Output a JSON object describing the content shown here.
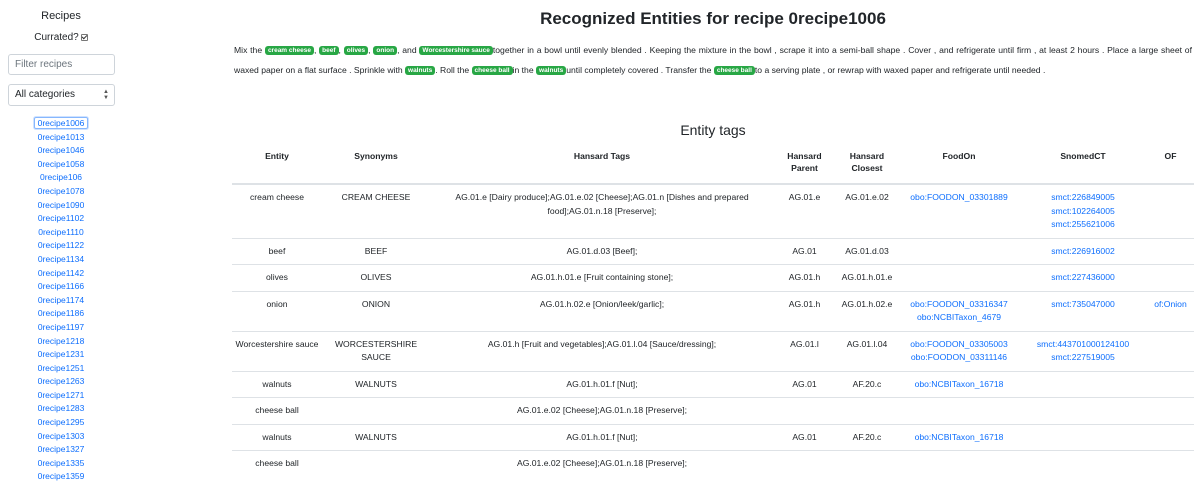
{
  "sidebar": {
    "title": "Recipes",
    "currated_label": "Currated?",
    "filter_placeholder": "Filter recipes",
    "category_selected": "All categories",
    "recipes": [
      "0recipe1006",
      "0recipe1013",
      "0recipe1046",
      "0recipe1058",
      "0recipe106",
      "0recipe1078",
      "0recipe1090",
      "0recipe1102",
      "0recipe1110",
      "0recipe1122",
      "0recipe1134",
      "0recipe1142",
      "0recipe1166",
      "0recipe1174",
      "0recipe1186",
      "0recipe1197",
      "0recipe1218",
      "0recipe1231",
      "0recipe1251",
      "0recipe1263",
      "0recipe1271",
      "0recipe1283",
      "0recipe1295",
      "0recipe1303",
      "0recipe1327",
      "0recipe1335",
      "0recipe1359"
    ],
    "active_recipe": "0recipe1006"
  },
  "main": {
    "title_prefix": "Recognized Entities for recipe",
    "recipe_id": "0recipe1006",
    "paragraph": [
      {
        "t": "Mix the "
      },
      {
        "e": "cream cheese"
      },
      {
        "t": ", "
      },
      {
        "e": "beef"
      },
      {
        "t": ", "
      },
      {
        "e": "olives"
      },
      {
        "t": ", "
      },
      {
        "e": "onion"
      },
      {
        "t": ", and "
      },
      {
        "e": "Worcestershire sauce"
      },
      {
        "t": "together in a bowl until evenly blended . Keeping the mixture in the bowl , scrape it into a semi-ball shape . Cover , and refrigerate until firm , at least 2 hours . Place a large sheet of waxed paper on a flat surface . Sprinkle with "
      },
      {
        "e": "walnuts"
      },
      {
        "t": ". Roll the "
      },
      {
        "e": "cheese ball"
      },
      {
        "t": "in the "
      },
      {
        "e": "walnuts"
      },
      {
        "t": "until completely covered . Transfer the "
      },
      {
        "e": "cheese ball"
      },
      {
        "t": "to a serving plate , or rewrap with waxed paper and refrigerate until needed ."
      }
    ],
    "section_title": "Entity tags",
    "columns": [
      {
        "label": "Entity",
        "width": 90
      },
      {
        "label": "Synonyms",
        "width": 108
      },
      {
        "label": "Hansard Tags",
        "width": 344
      },
      {
        "label": "Hansard Parent",
        "width": 61
      },
      {
        "label": "Hansard Closest",
        "width": 64
      },
      {
        "label": "FoodOn",
        "width": 120
      },
      {
        "label": "SnomedCT",
        "width": 128
      },
      {
        "label": "OF",
        "width": 47
      }
    ],
    "rows": [
      {
        "entity": "cream cheese",
        "synonyms": "CREAM CHEESE",
        "tags": "AG.01.e [Dairy produce];AG.01.e.02 [Cheese];AG.01.n [Dishes and prepared food];AG.01.n.18 [Preserve];",
        "parent": "AG.01.e",
        "closest": "AG.01.e.02",
        "foodon": [
          "obo:FOODON_03301889"
        ],
        "snomed": [
          "smct:226849005",
          "smct:102264005",
          "smct:255621006"
        ],
        "of": []
      },
      {
        "entity": "beef",
        "synonyms": "BEEF",
        "tags": "AG.01.d.03 [Beef];",
        "parent": "AG.01",
        "closest": "AG.01.d.03",
        "foodon": [],
        "snomed": [
          "smct:226916002"
        ],
        "of": []
      },
      {
        "entity": "olives",
        "synonyms": "OLIVES",
        "tags": "AG.01.h.01.e [Fruit containing stone];",
        "parent": "AG.01.h",
        "closest": "AG.01.h.01.e",
        "foodon": [],
        "snomed": [
          "smct:227436000"
        ],
        "of": []
      },
      {
        "entity": "onion",
        "synonyms": "ONION",
        "tags": "AG.01.h.02.e [Onion/leek/garlic];",
        "parent": "AG.01.h",
        "closest": "AG.01.h.02.e",
        "foodon": [
          "obo:FOODON_03316347",
          "obo:NCBITaxon_4679"
        ],
        "snomed": [
          "smct:735047000"
        ],
        "of": [
          "of:Onion"
        ]
      },
      {
        "entity": "Worcestershire sauce",
        "synonyms": "WORCESTERSHIRE SAUCE",
        "tags": "AG.01.h [Fruit and vegetables];AG.01.l.04 [Sauce/dressing];",
        "parent": "AG.01.l",
        "closest": "AG.01.l.04",
        "foodon": [
          "obo:FOODON_03305003",
          "obo:FOODON_03311146"
        ],
        "snomed": [
          "smct:443701000124100",
          "smct:227519005"
        ],
        "of": []
      },
      {
        "entity": "walnuts",
        "synonyms": "WALNUTS",
        "tags": "AG.01.h.01.f [Nut];",
        "parent": "AG.01",
        "closest": "AF.20.c",
        "foodon": [
          "obo:NCBITaxon_16718"
        ],
        "snomed": [],
        "of": []
      },
      {
        "entity": "cheese ball",
        "synonyms": "",
        "tags": "AG.01.e.02 [Cheese];AG.01.n.18 [Preserve];",
        "parent": "",
        "closest": "",
        "foodon": [],
        "snomed": [],
        "of": []
      },
      {
        "entity": "walnuts",
        "synonyms": "WALNUTS",
        "tags": "AG.01.h.01.f [Nut];",
        "parent": "AG.01",
        "closest": "AF.20.c",
        "foodon": [
          "obo:NCBITaxon_16718"
        ],
        "snomed": [],
        "of": []
      },
      {
        "entity": "cheese ball",
        "synonyms": "",
        "tags": "AG.01.e.02 [Cheese];AG.01.n.18 [Preserve];",
        "parent": "",
        "closest": "",
        "foodon": [],
        "snomed": [],
        "of": []
      }
    ]
  },
  "colors": {
    "accent": "#0d6efd",
    "entity_badge": "#28a745"
  }
}
